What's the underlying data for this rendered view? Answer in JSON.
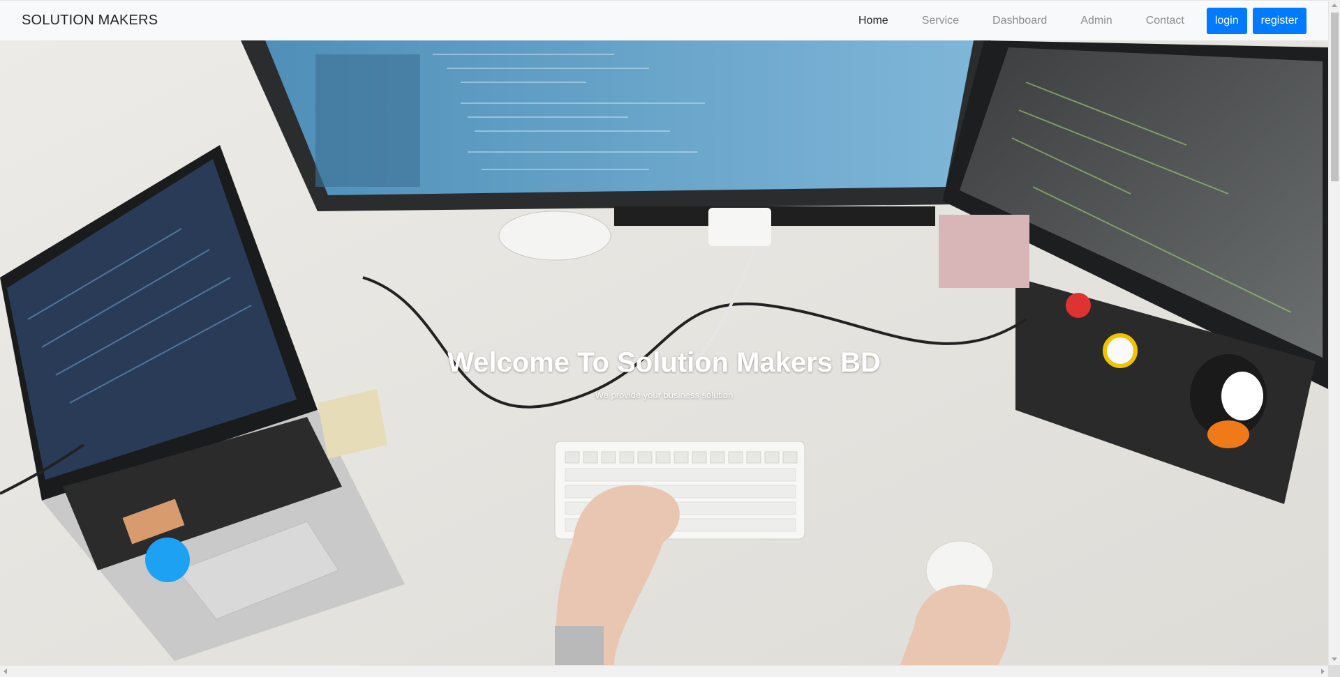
{
  "navbar": {
    "brand": "SOLUTION MAKERS",
    "links": [
      {
        "label": "Home"
      },
      {
        "label": "Service"
      },
      {
        "label": "Dashboard"
      },
      {
        "label": "Admin"
      },
      {
        "label": "Contact"
      }
    ],
    "buttons": {
      "login": "login",
      "register": "register"
    }
  },
  "hero": {
    "title": "Welcome To Solution Makers BD",
    "subtitle": "We provide your business solution"
  },
  "colors": {
    "primary": "#007bff",
    "navbar_bg": "#f8f9fa",
    "nav_active": "#212529",
    "nav_inactive": "#8a8d90"
  }
}
